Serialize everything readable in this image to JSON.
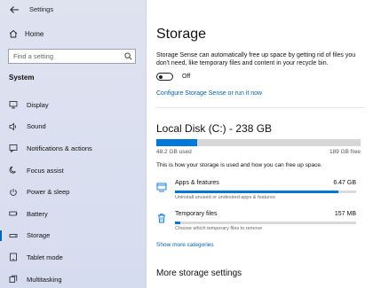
{
  "window": {
    "app_title": "Settings"
  },
  "sidebar": {
    "home_label": "Home",
    "search_placeholder": "Find a setting",
    "section_title": "System",
    "items": [
      {
        "label": "Display",
        "icon": "display-icon"
      },
      {
        "label": "Sound",
        "icon": "sound-icon"
      },
      {
        "label": "Notifications & actions",
        "icon": "notifications-icon"
      },
      {
        "label": "Focus assist",
        "icon": "focus-assist-icon"
      },
      {
        "label": "Power & sleep",
        "icon": "power-icon"
      },
      {
        "label": "Battery",
        "icon": "battery-icon"
      },
      {
        "label": "Storage",
        "icon": "storage-icon",
        "active": true
      },
      {
        "label": "Tablet mode",
        "icon": "tablet-icon"
      },
      {
        "label": "Multitasking",
        "icon": "multitasking-icon"
      }
    ]
  },
  "main": {
    "title": "Storage",
    "sense_description": "Storage Sense can automatically free up space by getting rid of files you don't need, like temporary files and content in your recycle bin.",
    "toggle_label": "Off",
    "toggle_on": false,
    "config_link": "Configure Storage Sense or run it now",
    "disk": {
      "title": "Local Disk (C:) - 238 GB",
      "used_label": "48.2 GB used",
      "free_label": "189 GB free",
      "used_fraction": 0.2,
      "description": "This is how your storage is used and how you can free up space."
    },
    "categories": [
      {
        "name": "Apps & features",
        "size": "6.47 GB",
        "description": "Uninstall unused or undesired apps & features",
        "fraction": 0.9
      },
      {
        "name": "Temporary files",
        "size": "157 MB",
        "description": "Choose which temporary files to remove",
        "fraction": 0.03
      }
    ],
    "more_categories_link": "Show more categories",
    "more_settings_title": "More storage settings"
  },
  "colors": {
    "accent": "#0078d7",
    "link": "#0063b1",
    "sidebar_bg": "#dbe0ef"
  }
}
